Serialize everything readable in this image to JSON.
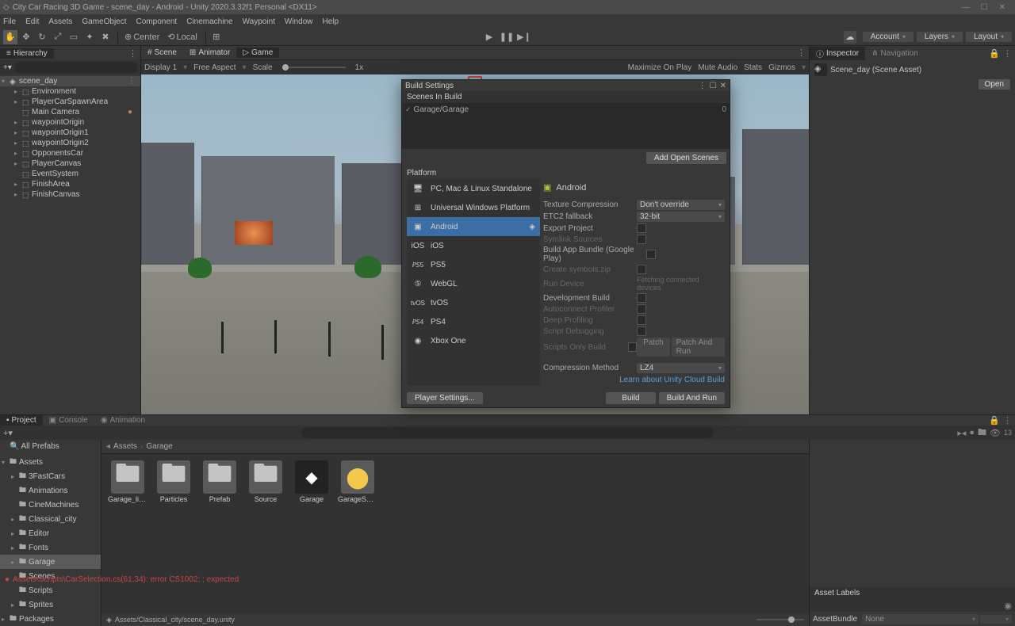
{
  "window": {
    "title": "City Car Racing 3D Game - scene_day - Android - Unity 2020.3.32f1 Personal <DX11>"
  },
  "menu": [
    "File",
    "Edit",
    "Assets",
    "GameObject",
    "Component",
    "Cinemachine",
    "Waypoint",
    "Window",
    "Help"
  ],
  "toolbar": {
    "center_label": "Center",
    "local_label": "Local",
    "account": "Account",
    "layers": "Layers",
    "layout": "Layout"
  },
  "hierarchy": {
    "tab": "Hierarchy",
    "scene": "scene_day",
    "items": [
      "Environment",
      "PlayerCarSpawnArea",
      "Main Camera",
      "waypointOrigin",
      "waypointOrigin1",
      "waypointOrigin2",
      "OpponentsCar",
      "PlayerCanvas",
      "EventSystem",
      "FinishArea",
      "FinishCanvas"
    ]
  },
  "scene": {
    "tabs": [
      "Scene",
      "Animator",
      "Game"
    ],
    "display": "Display 1",
    "aspect": "Free Aspect",
    "scale": "Scale",
    "scale_val": "1x",
    "right_opts": [
      "Maximize On Play",
      "Mute Audio",
      "Stats",
      "Gizmos"
    ]
  },
  "inspector": {
    "tabs": [
      "Inspector",
      "Navigation"
    ],
    "asset_name": "Scene_day (Scene Asset)",
    "open": "Open"
  },
  "build": {
    "title": "Build Settings",
    "scenes_in_build": "Scenes In Build",
    "scene_entry": "Garage/Garage",
    "scene_idx": "0",
    "add_open_scenes": "Add Open Scenes",
    "platform_header": "Platform",
    "platforms": [
      {
        "label": "PC, Mac & Linux Standalone",
        "ic": "🖥"
      },
      {
        "label": "Universal Windows Platform",
        "ic": "⊞"
      },
      {
        "label": "Android",
        "ic": "▣",
        "selected": true
      },
      {
        "label": "iOS",
        "ic": "iOS"
      },
      {
        "label": "PS5",
        "ic": "PS5"
      },
      {
        "label": "WebGL",
        "ic": "⑤"
      },
      {
        "label": "tvOS",
        "ic": "tvOS"
      },
      {
        "label": "PS4",
        "ic": "PS4"
      },
      {
        "label": "Xbox One",
        "ic": "◉"
      }
    ],
    "current_platform": "Android",
    "settings": {
      "texture_compression": {
        "label": "Texture Compression",
        "value": "Don't override"
      },
      "etc2": {
        "label": "ETC2 fallback",
        "value": "32-bit"
      },
      "export_project": "Export Project",
      "symlink": "Symlink Sources",
      "app_bundle": "Build App Bundle (Google Play)",
      "symbols": "Create symbols.zip",
      "run_device": "Run Device",
      "fetching": "Fetching connected devices.",
      "dev_build": "Development Build",
      "autoconnect": "Autoconnect Profiler",
      "deep_profiling": "Deep Profiling",
      "script_debug": "Script Debugging",
      "scripts_only": "Scripts Only Build",
      "patch": "Patch",
      "patch_run": "Patch And Run",
      "compression": {
        "label": "Compression Method",
        "value": "LZ4"
      }
    },
    "cloud_link": "Learn about Unity Cloud Build",
    "player_settings": "Player Settings...",
    "build_btn": "Build",
    "build_and_run": "Build And Run"
  },
  "project": {
    "tabs": [
      "Project",
      "Console",
      "Animation"
    ],
    "all_prefabs": "All Prefabs",
    "assets": "Assets",
    "folders": [
      "3FastCars",
      "Animations",
      "CineMachines",
      "Classical_city",
      "Editor",
      "Fonts",
      "Garage",
      "Scenes",
      "Scripts",
      "Sprites"
    ],
    "packages": "Packages",
    "breadcrumb": [
      "Assets",
      "Garage"
    ],
    "items": [
      {
        "name": "Garage_lig...",
        "type": "folder"
      },
      {
        "name": "Particles",
        "type": "folder"
      },
      {
        "name": "Prefab",
        "type": "folder"
      },
      {
        "name": "Source",
        "type": "folder"
      },
      {
        "name": "Garage",
        "type": "scene"
      },
      {
        "name": "GarageSetti...",
        "type": "settings"
      }
    ],
    "status_path": "Assets/Classical_city/scene_day.unity",
    "hidden_count": "13",
    "asset_labels": "Asset Labels",
    "asset_bundle": "AssetBundle",
    "none": "None"
  },
  "status": {
    "error": "Assets\\Scripts\\CarSelection.cs(61,34): error CS1002: ; expected"
  }
}
